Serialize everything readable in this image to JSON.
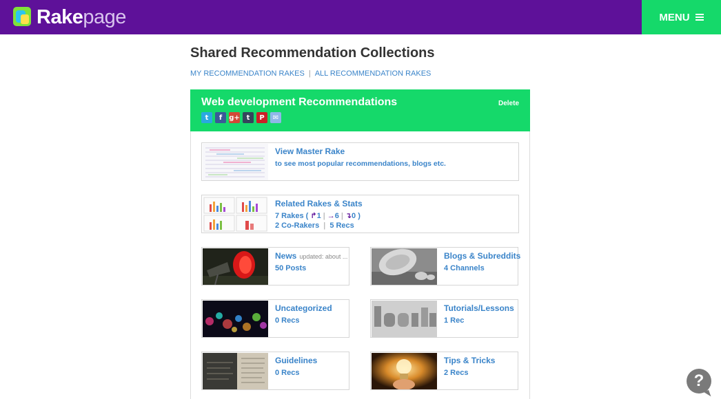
{
  "brand": {
    "name_bold": "Rake",
    "name_light": "page"
  },
  "menu": {
    "label": "MENU"
  },
  "page": {
    "title": "Shared Recommendation Collections",
    "links": [
      "MY RECOMMENDATION RAKES",
      "ALL RECOMMENDATION RAKES"
    ]
  },
  "collection": {
    "title": "Web development Recommendations",
    "delete_label": "Delete",
    "share_icons": [
      {
        "name": "twitter",
        "color": "#2aa9e0",
        "glyph": "t"
      },
      {
        "name": "facebook",
        "color": "#3b5998",
        "glyph": "f"
      },
      {
        "name": "google-plus",
        "color": "#d34836",
        "glyph": "g+"
      },
      {
        "name": "tumblr",
        "color": "#35465c",
        "glyph": "t"
      },
      {
        "name": "pinterest",
        "color": "#cb2027",
        "glyph": "P"
      },
      {
        "name": "email",
        "color": "#8fb7e8",
        "glyph": "✉"
      }
    ]
  },
  "master": {
    "title": "View Master Rake",
    "subtitle": "to see most popular recommendations, blogs etc."
  },
  "related": {
    "title": "Related Rakes & Stats",
    "rakes_label": "7 Rakes (",
    "up": "1",
    "right": "6",
    "down": "0",
    "close": ")",
    "corakers": "2 Co-Rakers",
    "recs": "5 Recs"
  },
  "tiles": [
    {
      "title": "News",
      "note": "updated: about ...",
      "count": "50 Posts"
    },
    {
      "title": "Blogs & Subreddits",
      "count": "4 Channels"
    },
    {
      "title": "Uncategorized",
      "count": "0 Recs"
    },
    {
      "title": "Tutorials/Lessons",
      "count": "1 Rec"
    },
    {
      "title": "Guidelines",
      "count": "0 Recs"
    },
    {
      "title": "Tips & Tricks",
      "count": "2 Recs"
    }
  ],
  "help": {
    "glyph": "?"
  }
}
